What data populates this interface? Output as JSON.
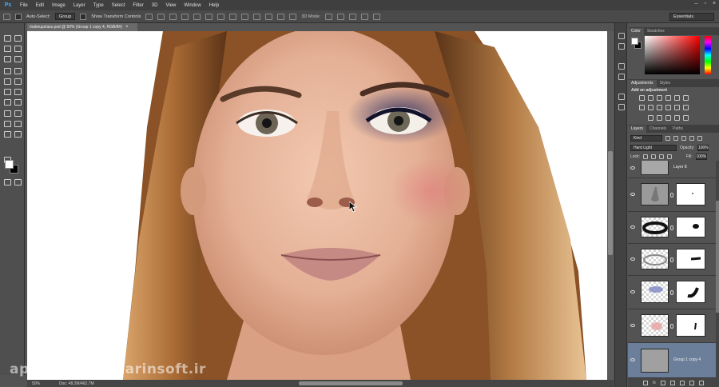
{
  "app": {
    "logo": "Ps",
    "menu": [
      "File",
      "Edit",
      "Image",
      "Layer",
      "Type",
      "Select",
      "Filter",
      "3D",
      "View",
      "Window",
      "Help"
    ],
    "window_controls": [
      "–",
      "▫",
      "×"
    ]
  },
  "options_bar": {
    "auto_select_label": "Auto-Select:",
    "auto_select_target": "Group",
    "transform_controls_label": "Show Transform Controls",
    "mode_3d_label": "3D Mode:",
    "workspace": "Essentials"
  },
  "document": {
    "tab_title": "makeupclass.psd @ 50% (Group 1 copy 4, RGB/8#)",
    "tab_close": "×",
    "zoom": "50%",
    "doc_size": "Doc: 48.2M/462.7M"
  },
  "panels": {
    "color_tabs": [
      "Color",
      "Swatches"
    ],
    "adjustments_tabs": [
      "Adjustments",
      "Styles"
    ],
    "adjustments_title": "Add an adjustment",
    "layers_tabs": [
      "Layers",
      "Channels",
      "Paths"
    ],
    "filter_kind": "Kind",
    "blend_mode": "Hard Light",
    "opacity_label": "Opacity:",
    "opacity_value": "100%",
    "lock_label": "Lock:",
    "fill_label": "Fill:",
    "fill_value": "100%",
    "fx_label": "fx"
  },
  "layers": [
    {
      "name": "Layer 8",
      "selected": false
    },
    {
      "name": "",
      "selected": false
    },
    {
      "name": "",
      "selected": false
    },
    {
      "name": "",
      "selected": false
    },
    {
      "name": "",
      "selected": false
    },
    {
      "name": "",
      "selected": false
    },
    {
      "name": "Group 1 copy 4",
      "selected": true
    }
  ],
  "watermark": {
    "left": "ap",
    "right": "arinsoft.ir"
  },
  "colors": {
    "ui_dark": "#3f3f3f",
    "ui_mid": "#535353",
    "selection": "#6b7e9a",
    "accent_blue": "#4aa8ff"
  }
}
